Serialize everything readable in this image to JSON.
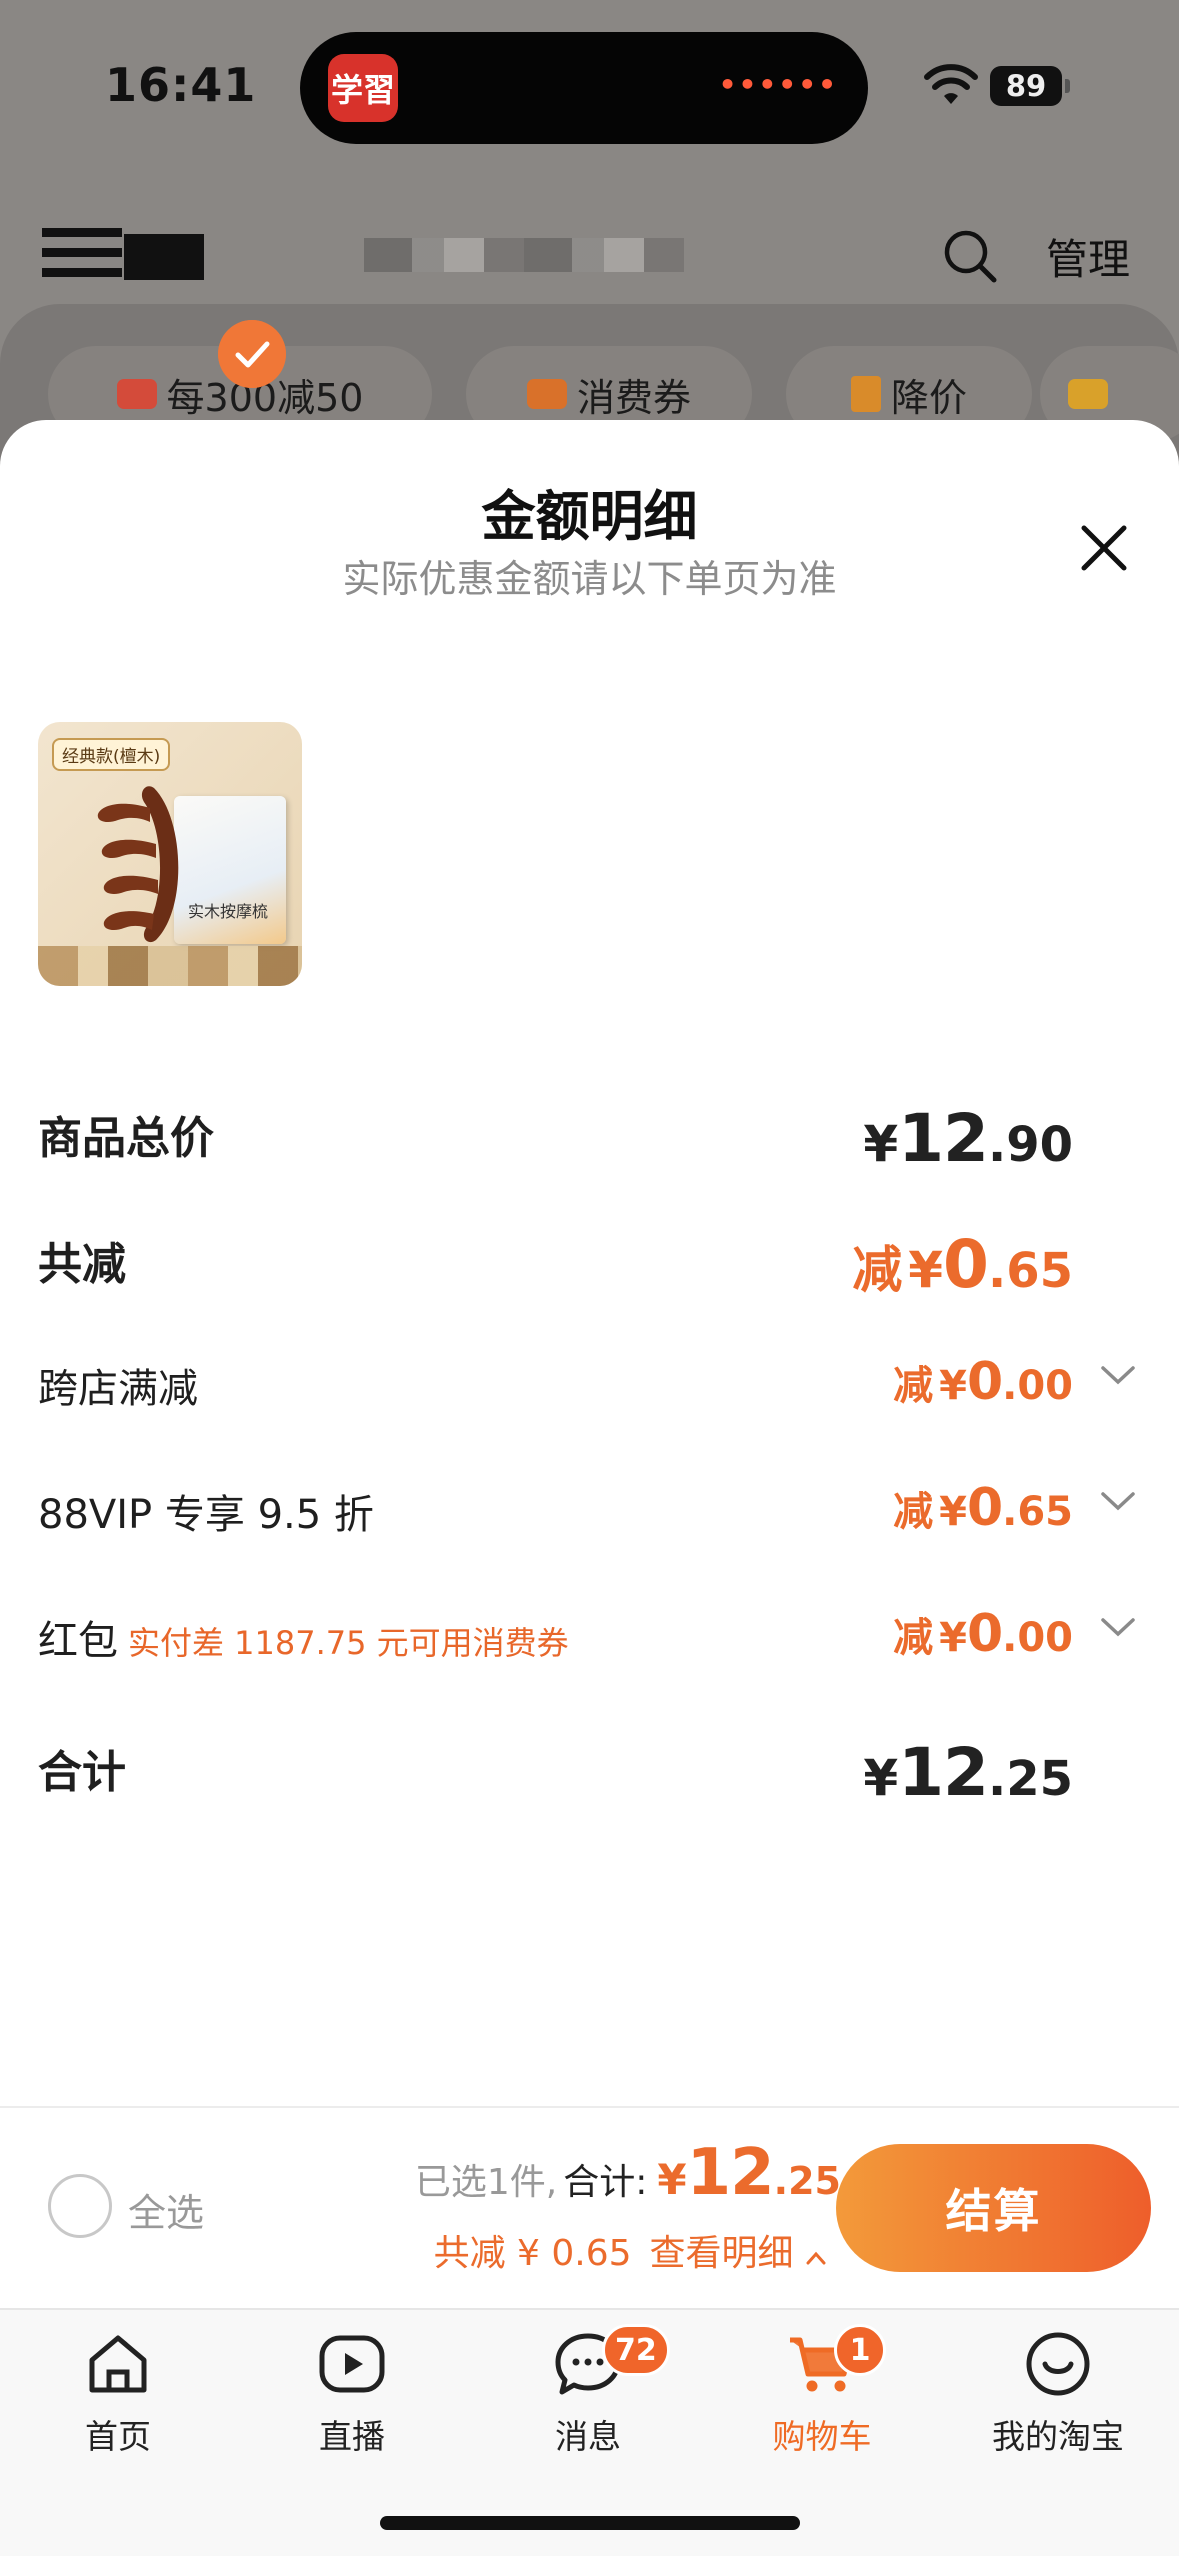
{
  "status_bar": {
    "time": "16:41",
    "battery": "89",
    "island_app": "学習"
  },
  "header": {
    "manage_label": "管理"
  },
  "promo_chips": [
    {
      "label": "每300减50",
      "icon": "coupon-icon",
      "color": "#d44b3a"
    },
    {
      "label": "消费券",
      "icon": "voucher-icon",
      "color": "#d9712a"
    },
    {
      "label": "降价",
      "icon": "price-drop-icon",
      "color": "#d98b2a"
    },
    {
      "label": "",
      "icon": "folder-icon",
      "color": "#d9a12a"
    }
  ],
  "sheet": {
    "title": "金额明细",
    "subtitle": "实际优惠金额请以下单页为准",
    "product": {
      "tag": "经典款(檀木)",
      "box_text": "实木按摩梳"
    },
    "rows": {
      "total_price": {
        "label": "商品总价",
        "currency": "¥",
        "int": "12",
        "dec": ".90"
      },
      "total_discount": {
        "label": "共减",
        "prefix": "减",
        "currency": "¥",
        "int": "0",
        "dec": ".65"
      },
      "cross_store": {
        "label": "跨店满减",
        "prefix": "减",
        "currency": "¥",
        "int": "0",
        "dec": ".00"
      },
      "vip": {
        "label": "88VIP 专享 9.5 折",
        "prefix": "减",
        "currency": "¥",
        "int": "0",
        "dec": ".65"
      },
      "red_packet": {
        "label": "红包",
        "note": "实付差 1187.75 元可用消费券",
        "prefix": "减",
        "currency": "¥",
        "int": "0",
        "dec": ".00"
      },
      "sum": {
        "label": "合计",
        "currency": "¥",
        "int": "12",
        "dec": ".25"
      }
    }
  },
  "checkout": {
    "select_all": "全选",
    "selected_text": "已选1件,",
    "sum_label": "合计:",
    "currency": "¥",
    "int": "12",
    "dec": ".25",
    "saved_text": "共减 ¥ 0.65",
    "details_link": "查看明细",
    "settle_label": "结算",
    "accent": "#ee6a2b"
  },
  "tabbar": {
    "items": [
      {
        "label": "首页",
        "icon": "home-icon"
      },
      {
        "label": "直播",
        "icon": "live-play-icon"
      },
      {
        "label": "消息",
        "icon": "message-icon",
        "badge": "72"
      },
      {
        "label": "购物车",
        "icon": "cart-icon",
        "badge": "1",
        "active": true
      },
      {
        "label": "我的淘宝",
        "icon": "profile-icon"
      }
    ]
  }
}
